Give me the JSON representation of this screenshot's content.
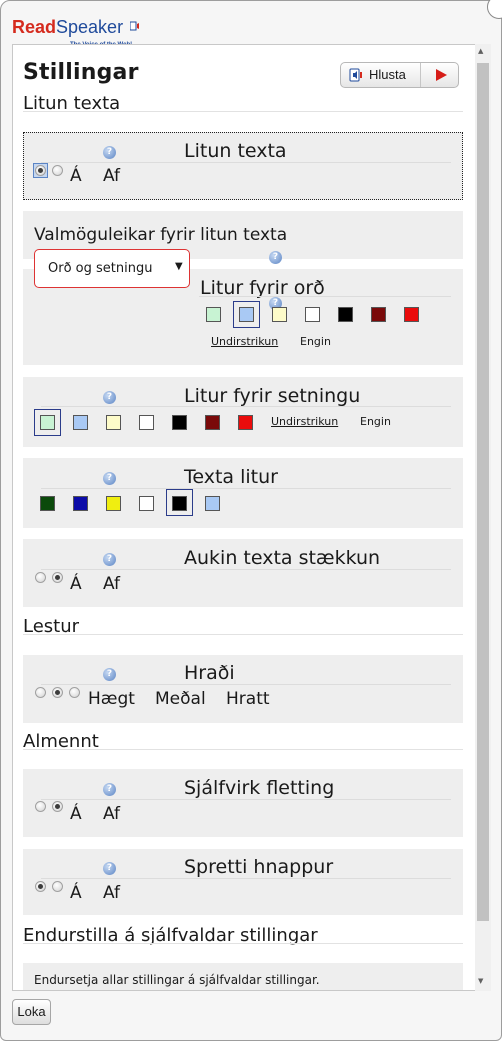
{
  "logo": {
    "read": "Read",
    "speaker": "Speaker",
    "tagline": "The Voice of the Web!"
  },
  "header": {
    "title": "Stillingar",
    "listen_label": "Hlusta"
  },
  "colors": {
    "red": "#d61d18",
    "focus": "#5b84c4",
    "panel_bg": "#eeeeee"
  },
  "sections": {
    "litun": "Litun texta",
    "lestur": "Lestur",
    "almennt": "Almennt",
    "reset": "Endurstilla á sjálfvaldar stillingar"
  },
  "litun_texta": {
    "title": "Litun texta",
    "on": "Á",
    "off": "Af",
    "selected": "Á"
  },
  "valmoguleikar": {
    "title": "Valmöguleikar fyrir litun texta",
    "selected": "Orð og setningu"
  },
  "litur_ord": {
    "title": "Litur fyrir orð",
    "swatches": [
      "#c8f3d3",
      "#a9c9f4",
      "#fdfbc9",
      "#ffffff",
      "#000000",
      "#7a0a0a",
      "#ea0c0c"
    ],
    "selected": "#a9c9f4",
    "underline": "Undirstrikun",
    "none": "Engin"
  },
  "litur_setningu": {
    "title": "Litur fyrir setningu",
    "swatches": [
      "#c8f3d3",
      "#a9c9f4",
      "#fdfbc9",
      "#ffffff",
      "#000000",
      "#7a0a0a",
      "#ea0c0c"
    ],
    "selected": "#c8f3d3",
    "underline": "Undirstrikun",
    "none": "Engin"
  },
  "texta_litur": {
    "title": "Texta litur",
    "swatches": [
      "#0b4a0b",
      "#0c0ca8",
      "#f0ee10",
      "#ffffff",
      "#000000",
      "#a9c9f4"
    ],
    "selected": "#000000"
  },
  "aukin": {
    "title": "Aukin texta stækkun",
    "on": "Á",
    "off": "Af",
    "selected": "Af"
  },
  "hradi": {
    "title": "Hraði",
    "slow": "Hægt",
    "medium": "Meðal",
    "fast": "Hratt",
    "selected": "Meðal"
  },
  "sjalfvirk": {
    "title": "Sjálfvirk fletting",
    "on": "Á",
    "off": "Af",
    "selected": "Af"
  },
  "spretti": {
    "title": "Spretti hnappur",
    "on": "Á",
    "off": "Af",
    "selected": "Á"
  },
  "reset": {
    "text": "Endursetja allar stillingar á sjálfvaldar stillingar."
  },
  "footer": {
    "close": "Loka"
  }
}
